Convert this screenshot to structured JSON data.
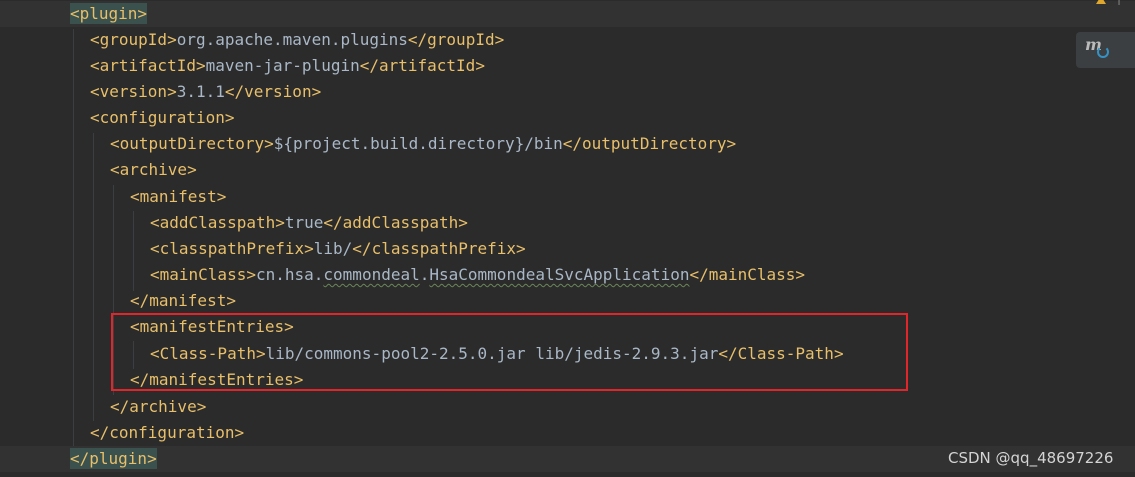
{
  "editor": {
    "lines": [
      {
        "open": "<plugin>"
      },
      {
        "open": "<groupId>",
        "text": "org.apache.maven.plugins",
        "close": "</groupId>"
      },
      {
        "open": "<artifactId>",
        "text": "maven-jar-plugin",
        "close": "</artifactId>"
      },
      {
        "open": "<version>",
        "text": "3.1.1",
        "close": "</version>"
      },
      {
        "open": "<configuration>"
      },
      {
        "open": "<outputDirectory>",
        "text": "${project.build.directory}/bin",
        "close": "</outputDirectory>"
      },
      {
        "open": "<archive>"
      },
      {
        "open": "<manifest>"
      },
      {
        "open": "<addClasspath>",
        "text": "true",
        "close": "</addClasspath>"
      },
      {
        "open": "<classpathPrefix>",
        "text": "lib/",
        "close": "</classpathPrefix>"
      },
      {
        "open": "<mainClass>",
        "text_a": "cn.hsa.",
        "text_b": "commondeal",
        "text_c": ".",
        "text_d": "HsaCommondealSvcApplication",
        "close": "</mainClass>"
      },
      {
        "open": "</manifest>"
      },
      {
        "open": "<manifestEntries>"
      },
      {
        "open": "<Class-Path>",
        "text": "lib/commons-pool2-2.5.0.jar lib/jedis-2.9.3.jar",
        "close": "</Class-Path>"
      },
      {
        "open": "</manifestEntries>"
      },
      {
        "open": "</archive>"
      },
      {
        "open": "</configuration>"
      },
      {
        "open": "</plugin>"
      }
    ]
  },
  "toolbar": {
    "maven_icon": "m-refresh-icon",
    "warning_icon": "warning-icon"
  },
  "watermark": {
    "text": "CSDN @qq_48697226"
  },
  "colors": {
    "background": "#2b2b2b",
    "tag": "#e8bf6a",
    "text": "#a9b7c6",
    "highlight_box": "#e0262b",
    "brace_match": "#3b514d"
  }
}
